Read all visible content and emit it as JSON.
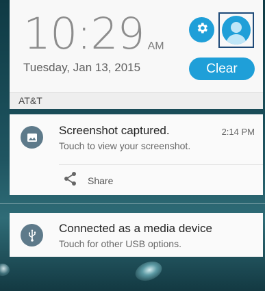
{
  "clock": {
    "time": "10:29",
    "ampm": "AM",
    "date": "Tuesday, Jan 13, 2015"
  },
  "quick_settings": {
    "settings_icon": "gear-icon",
    "profile_icon": "user-avatar-icon",
    "clear_label": "Clear"
  },
  "carrier": {
    "name": "AT&T"
  },
  "notifications": [
    {
      "app_icon": "image-icon",
      "title": "Screenshot captured.",
      "body": "Touch to view your screenshot.",
      "time": "2:14 PM",
      "action": {
        "icon": "share-icon",
        "label": "Share"
      }
    },
    {
      "app_icon": "usb-icon",
      "title": "Connected as a media device",
      "body": "Touch for other USB options."
    }
  ],
  "colors": {
    "accent": "#1f9fd8",
    "panel": "#f8f8f8",
    "wallpaper": "#1f5561",
    "app_icon_bg": "#5e7a8a"
  }
}
